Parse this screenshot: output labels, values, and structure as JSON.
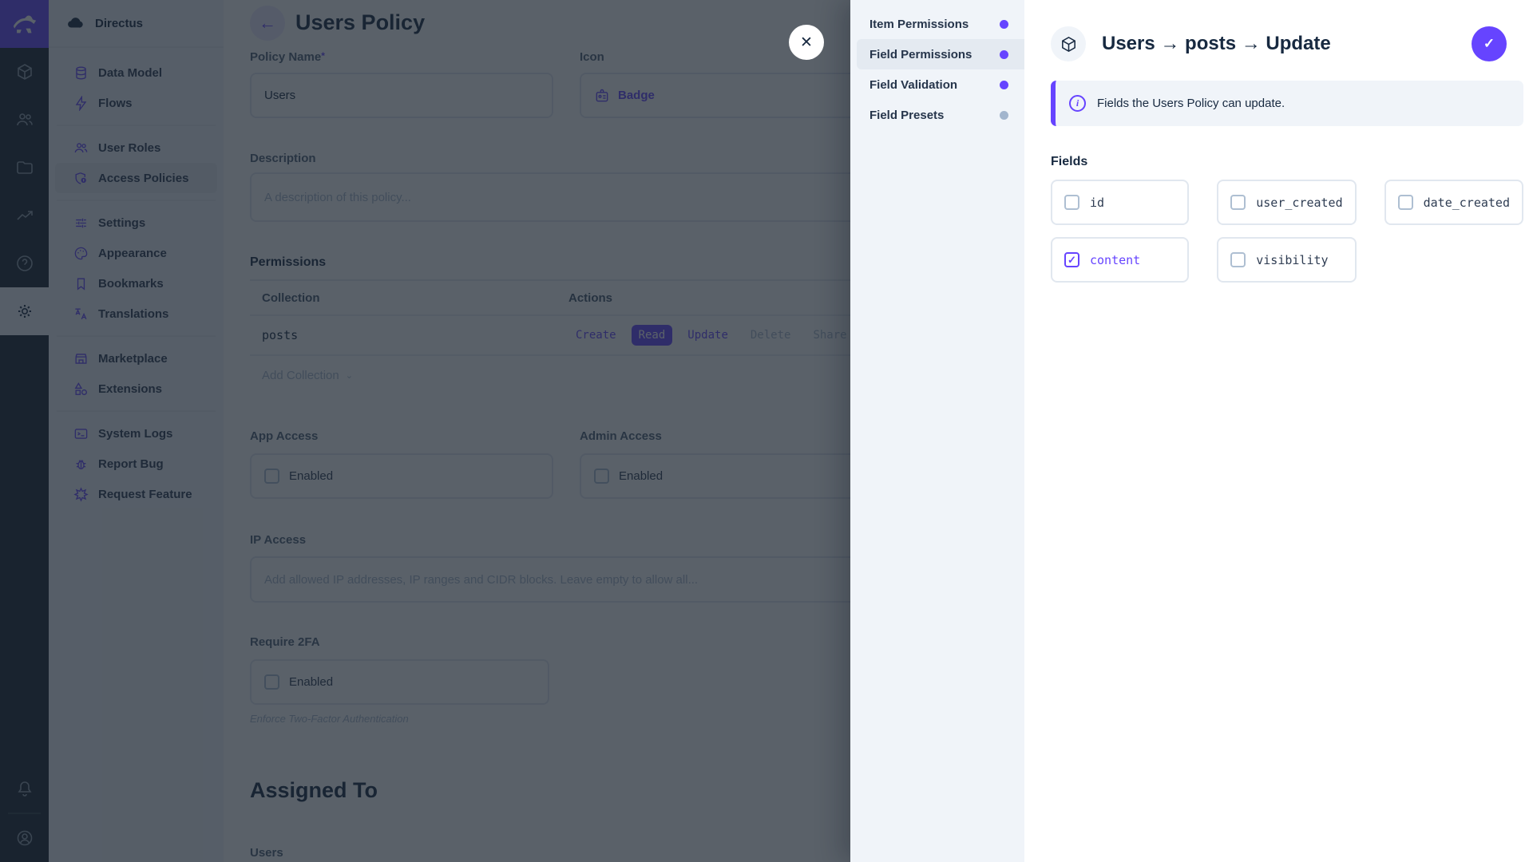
{
  "brand": {
    "accent": "#6644ff",
    "name": "Directus"
  },
  "module_bar": {
    "icons": [
      "content-collections",
      "user-directory",
      "file-library",
      "insights",
      "documentation-help",
      "settings"
    ],
    "bottom_icons": [
      "notifications",
      "user-avatar"
    ]
  },
  "sidebar": {
    "project_name": "Directus",
    "items": [
      {
        "label": "Data Model"
      },
      {
        "label": "Flows"
      },
      {
        "label": "User Roles"
      },
      {
        "label": "Access Policies",
        "active": true
      },
      {
        "label": "Settings"
      },
      {
        "label": "Appearance"
      },
      {
        "label": "Bookmarks"
      },
      {
        "label": "Translations"
      },
      {
        "label": "Marketplace"
      },
      {
        "label": "Extensions"
      },
      {
        "label": "System Logs"
      },
      {
        "label": "Report Bug"
      },
      {
        "label": "Request Feature"
      }
    ]
  },
  "main": {
    "back_glyph": "←",
    "title": "Users Policy",
    "policy_name": {
      "label": "Policy Name",
      "required_mark": "*",
      "value": "Users"
    },
    "icon_field": {
      "label": "Icon",
      "value": "Badge"
    },
    "description": {
      "label": "Description",
      "placeholder": "A description of this policy..."
    },
    "permissions": {
      "heading": "Permissions",
      "columns": {
        "collection": "Collection",
        "actions": "Actions"
      },
      "rows": [
        {
          "collection": "posts",
          "actions": [
            {
              "label": "Create",
              "state": "enabled"
            },
            {
              "label": "Read",
              "state": "selected"
            },
            {
              "label": "Update",
              "state": "enabled"
            },
            {
              "label": "Delete",
              "state": "disabled"
            },
            {
              "label": "Share",
              "state": "disabled"
            }
          ]
        }
      ],
      "add_collection_label": "Add Collection",
      "add_collection_chevron": "⌄"
    },
    "app_access": {
      "label": "App Access",
      "checkbox_label": "Enabled",
      "checked": false
    },
    "admin_access": {
      "label": "Admin Access",
      "checkbox_label": "Enabled",
      "checked": false
    },
    "ip_access": {
      "label": "IP Access",
      "placeholder": "Add allowed IP addresses, IP ranges and CIDR blocks. Leave empty to allow all..."
    },
    "require_2fa": {
      "label": "Require 2FA",
      "checkbox_label": "Enabled",
      "checked": false,
      "note": "Enforce Two-Factor Authentication"
    },
    "assigned_to": {
      "heading": "Assigned To",
      "field_label": "Users"
    }
  },
  "drawer": {
    "close_glyph": "✕",
    "nav": [
      {
        "label": "Item Permissions",
        "dot_color": "#6644ff"
      },
      {
        "label": "Field Permissions",
        "dot_color": "#6644ff",
        "active": true
      },
      {
        "label": "Field Validation",
        "dot_color": "#6644ff"
      },
      {
        "label": "Field Presets",
        "dot_color": "#a2b5cd"
      }
    ],
    "title": "Users → posts → Update",
    "save_glyph": "✓",
    "banner_text": "Fields the Users Policy can update.",
    "info_glyph": "i",
    "fields_heading": "Fields",
    "fields": [
      {
        "label": "id",
        "checked": false
      },
      {
        "label": "user_created",
        "checked": false
      },
      {
        "label": "date_created",
        "checked": false
      },
      {
        "label": "content",
        "checked": true
      },
      {
        "label": "visibility",
        "checked": false
      }
    ]
  }
}
